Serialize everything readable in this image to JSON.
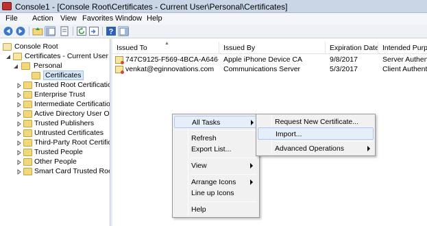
{
  "window": {
    "title": "Console1 - [Console Root\\Certificates - Current User\\Personal\\Certificates]"
  },
  "menubar": {
    "items": [
      "File",
      "Action",
      "View",
      "Favorites",
      "Window",
      "Help"
    ]
  },
  "toolbar": {
    "buttons": [
      "back-icon",
      "forward-icon",
      "up-folder-icon",
      "show-tree-icon",
      "properties-icon",
      "refresh-icon",
      "export-list-icon",
      "help-icon",
      "action-pane-icon"
    ]
  },
  "tree": {
    "root": "Console Root",
    "store": "Certificates - Current User",
    "personal": "Personal",
    "certificates": "Certificates",
    "folders": [
      "Trusted Root Certification A",
      "Enterprise Trust",
      "Intermediate Certification A",
      "Active Directory User Objec",
      "Trusted Publishers",
      "Untrusted Certificates",
      "Third-Party Root Certificat",
      "Trusted People",
      "Other People",
      "Smart Card Trusted Roots"
    ]
  },
  "list": {
    "columns": [
      "Issued To",
      "Issued By",
      "Expiration Date",
      "Intended Purpo"
    ],
    "rows": [
      {
        "issued_to": "747C9125-F569-4BCA-A646-79F...",
        "issued_by": "Apple iPhone Device CA",
        "expiration": "9/8/2017",
        "purpose": "Server Authenti"
      },
      {
        "issued_to": "venkat@eginnovations.com",
        "issued_by": "Communications Server",
        "expiration": "5/3/2017",
        "purpose": "Client Authenti"
      }
    ]
  },
  "context_menu": {
    "all_tasks": "All Tasks",
    "refresh": "Refresh",
    "export_list": "Export List...",
    "view": "View",
    "arrange_icons": "Arrange Icons",
    "line_up_icons": "Line up Icons",
    "help": "Help"
  },
  "submenu": {
    "request_new": "Request New Certificate...",
    "import": "Import...",
    "advanced": "Advanced Operations"
  }
}
